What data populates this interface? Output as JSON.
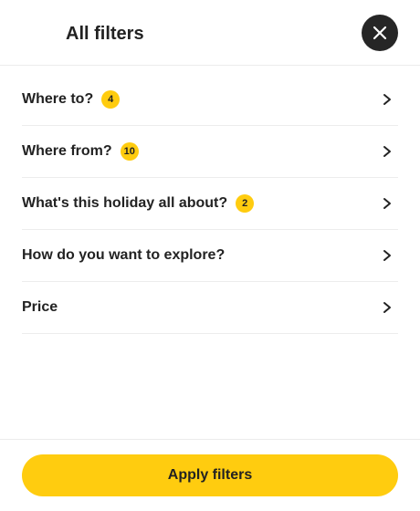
{
  "header": {
    "title": "All filters",
    "close_icon": "close-icon"
  },
  "filters": [
    {
      "label": "Where to?",
      "count": "4"
    },
    {
      "label": "Where from?",
      "count": "10"
    },
    {
      "label": "What's this holiday all about?",
      "count": "2"
    },
    {
      "label": "How do you want to explore?",
      "count": ""
    },
    {
      "label": "Price",
      "count": ""
    }
  ],
  "footer": {
    "apply_label": "Apply filters"
  },
  "colors": {
    "accent": "#ffcc0f",
    "close_button": "#262626",
    "text": "#222222",
    "divider": "#ececec"
  }
}
